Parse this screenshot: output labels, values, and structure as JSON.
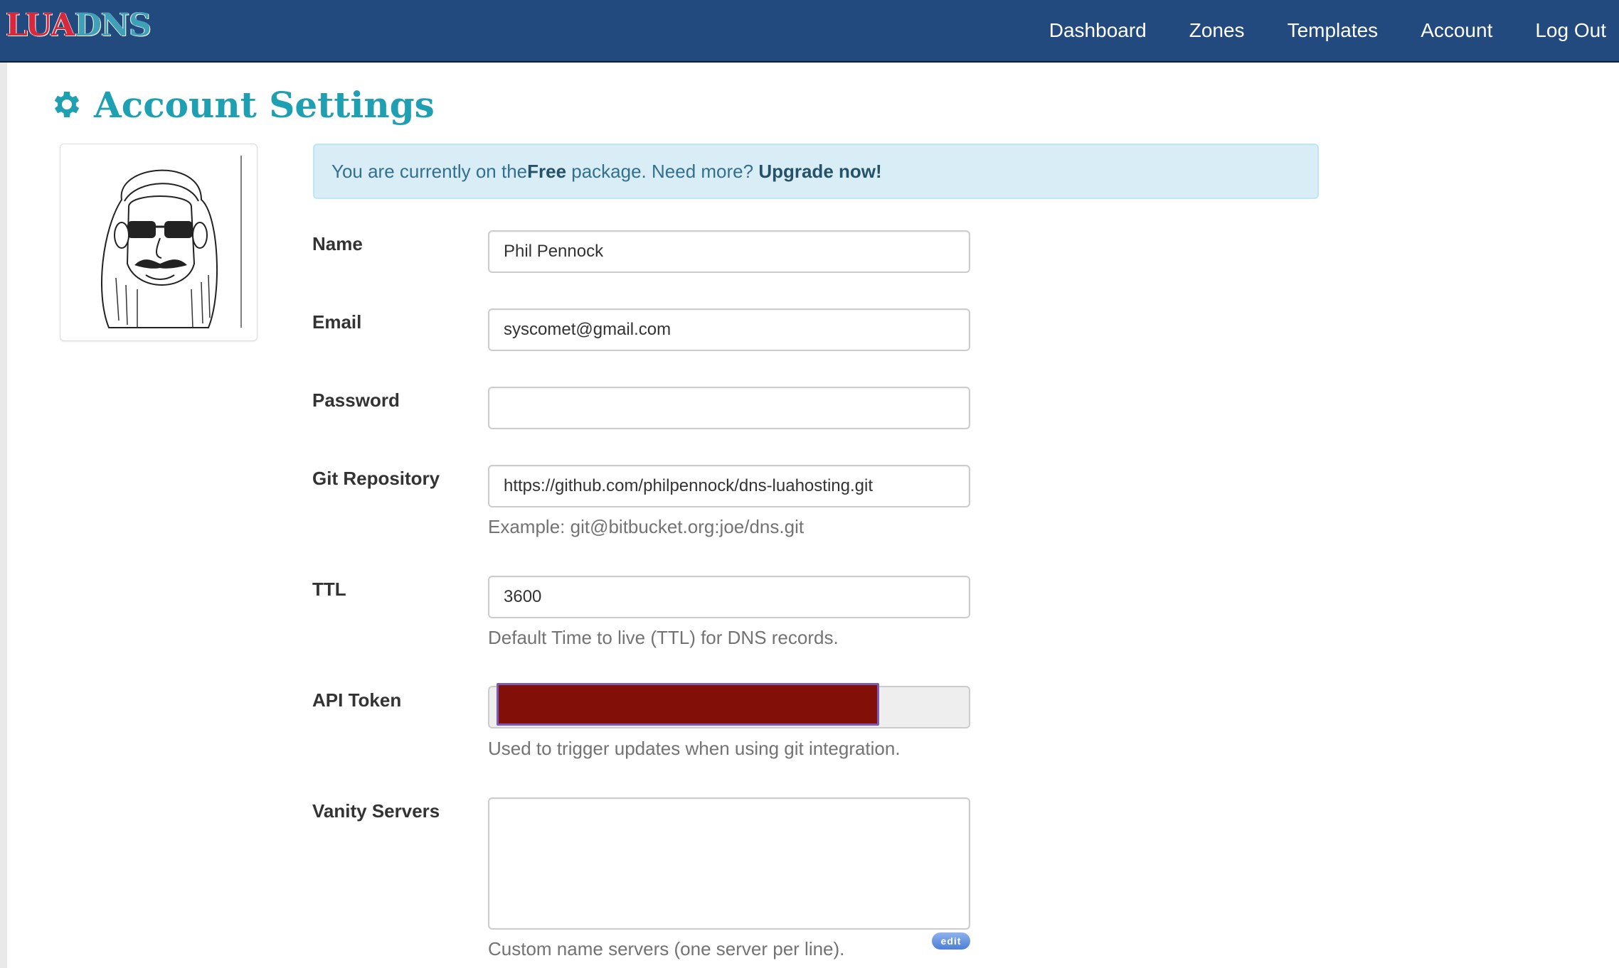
{
  "brand": {
    "part1": "LUA",
    "part2": "DNS"
  },
  "nav": {
    "items": [
      {
        "label": "Dashboard"
      },
      {
        "label": "Zones"
      },
      {
        "label": "Templates"
      },
      {
        "label": "Account"
      },
      {
        "label": "Log Out"
      }
    ]
  },
  "page": {
    "title": "Account Settings",
    "title_icon": "gear-icon"
  },
  "alert": {
    "text_before": "You are currently on the ",
    "package": "Free",
    "text_after": " package. Need more? ",
    "link": "Upgrade now!"
  },
  "form": {
    "name": {
      "label": "Name",
      "value": "Phil Pennock"
    },
    "email": {
      "label": "Email",
      "value": "syscomet@gmail.com"
    },
    "password": {
      "label": "Password",
      "value": ""
    },
    "git": {
      "label": "Git Repository",
      "value": "https://github.com/philpennock/dns-luahosting.git",
      "help": "Example: git@bitbucket.org:joe/dns.git"
    },
    "ttl": {
      "label": "TTL",
      "value": "3600",
      "help": "Default Time to live (TTL) for DNS records."
    },
    "api_token": {
      "label": "API Token",
      "help": "Used to trigger updates when using git integration."
    },
    "vanity": {
      "label": "Vanity Servers",
      "value": "",
      "help": "Custom name servers (one server per line)."
    }
  },
  "edit_badge": "edit",
  "colors": {
    "navbar": "#234a7e",
    "title": "#1fa0b2",
    "alert_bg": "#d9edf7",
    "redaction": "#831008"
  }
}
